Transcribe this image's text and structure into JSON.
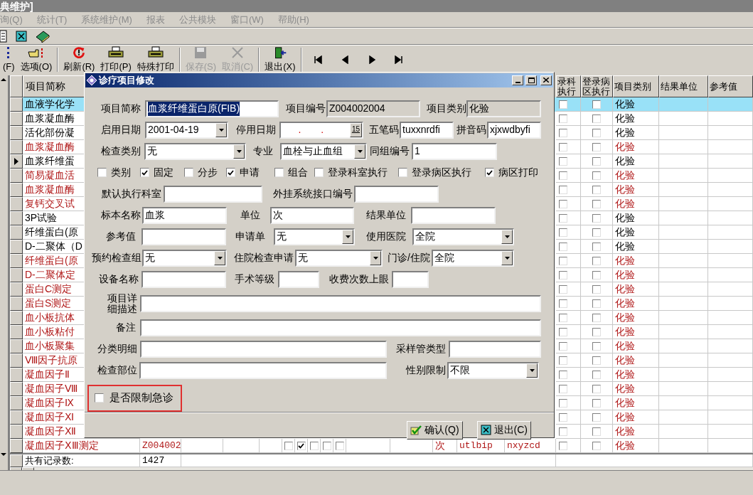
{
  "window": {
    "title": "典维护]"
  },
  "menu": [
    {
      "label": "询(Q)",
      "disabled": true
    },
    {
      "label": "统计(T)",
      "disabled": true
    },
    {
      "label": "系统维护(M)",
      "disabled": true
    },
    {
      "label": "报表",
      "disabled": true
    },
    {
      "label": "公共模块",
      "disabled": true
    },
    {
      "label": "窗口(W)",
      "disabled": true
    },
    {
      "label": "帮助(H)",
      "disabled": true
    }
  ],
  "quick_icons": [
    {
      "kind": "document"
    },
    {
      "kind": "close"
    },
    {
      "kind": "book"
    }
  ],
  "toolbar": [
    {
      "kind": "dots",
      "label": "(F)",
      "disabled": false,
      "divider_after": false
    },
    {
      "kind": "options",
      "label": "选项(O)",
      "disabled": false,
      "divider_after": true
    },
    {
      "kind": "refresh",
      "label": "刷新(R)",
      "disabled": false,
      "divider_after": false
    },
    {
      "kind": "print",
      "label": "打印(P)",
      "disabled": false,
      "divider_after": false
    },
    {
      "kind": "print",
      "label": "特殊打印",
      "disabled": false,
      "divider_after": true
    },
    {
      "kind": "save",
      "label": "保存(S)",
      "disabled": true,
      "divider_after": false
    },
    {
      "kind": "cancel",
      "label": "取消(C)",
      "disabled": true,
      "divider_after": true
    },
    {
      "kind": "exit",
      "label": "退出(X)",
      "disabled": false,
      "divider_after": true
    }
  ],
  "nav": [
    {
      "kind": "first"
    },
    {
      "kind": "prev"
    },
    {
      "kind": "next"
    },
    {
      "kind": "last"
    }
  ],
  "grid": {
    "name_header": "项目简称",
    "right_headers": [
      [
        "录科",
        "执行"
      ],
      [
        "登录病",
        "区执行"
      ],
      [
        "项目类别"
      ],
      [
        "结果单位"
      ],
      [
        "参考值"
      ]
    ],
    "rows": [
      {
        "name": "血液学化学",
        "color": "#000000",
        "selected": true,
        "current": false,
        "exec_dept": false,
        "exec_ward": false,
        "category": "化验"
      },
      {
        "name": "血浆凝血酶",
        "color": "#000000",
        "selected": false,
        "current": false,
        "exec_dept": false,
        "exec_ward": false,
        "category": "化验"
      },
      {
        "name": "活化部份凝",
        "color": "#000000",
        "selected": false,
        "current": false,
        "exec_dept": false,
        "exec_ward": false,
        "category": "化验"
      },
      {
        "name": "血浆凝血酶",
        "color": "#b01818",
        "selected": false,
        "current": false,
        "exec_dept": false,
        "exec_ward": false,
        "category": "化验"
      },
      {
        "name": "血浆纤维蛋",
        "color": "#000000",
        "selected": false,
        "current": true,
        "exec_dept": false,
        "exec_ward": false,
        "category": "化验"
      },
      {
        "name": "简易凝血活",
        "color": "#b01818",
        "selected": false,
        "current": false,
        "exec_dept": false,
        "exec_ward": false,
        "category": "化验"
      },
      {
        "name": "血浆凝血酶",
        "color": "#b01818",
        "selected": false,
        "current": false,
        "exec_dept": false,
        "exec_ward": false,
        "category": "化验"
      },
      {
        "name": "复钙交叉试",
        "color": "#b01818",
        "selected": false,
        "current": false,
        "exec_dept": false,
        "exec_ward": false,
        "category": "化验"
      },
      {
        "name": "3P试验",
        "color": "#000000",
        "selected": false,
        "current": false,
        "exec_dept": false,
        "exec_ward": false,
        "category": "化验"
      },
      {
        "name": "纤维蛋白(原",
        "color": "#000000",
        "selected": false,
        "current": false,
        "exec_dept": false,
        "exec_ward": false,
        "category": "化验"
      },
      {
        "name": "D-二聚体（D",
        "color": "#000000",
        "selected": false,
        "current": false,
        "exec_dept": false,
        "exec_ward": false,
        "category": "化验"
      },
      {
        "name": "纤维蛋白(原",
        "color": "#b01818",
        "selected": false,
        "current": false,
        "exec_dept": false,
        "exec_ward": false,
        "category": "化验"
      },
      {
        "name": "D-二聚体定",
        "color": "#b01818",
        "selected": false,
        "current": false,
        "exec_dept": false,
        "exec_ward": false,
        "category": "化验"
      },
      {
        "name": "蛋白C测定",
        "color": "#b01818",
        "selected": false,
        "current": false,
        "exec_dept": false,
        "exec_ward": false,
        "category": "化验"
      },
      {
        "name": "蛋白S测定",
        "color": "#b01818",
        "selected": false,
        "current": false,
        "exec_dept": false,
        "exec_ward": false,
        "category": "化验"
      },
      {
        "name": "血小板抗体",
        "color": "#b01818",
        "selected": false,
        "current": false,
        "exec_dept": false,
        "exec_ward": false,
        "category": "化验"
      },
      {
        "name": "血小板粘付",
        "color": "#b01818",
        "selected": false,
        "current": false,
        "exec_dept": false,
        "exec_ward": false,
        "category": "化验"
      },
      {
        "name": "血小板聚集",
        "color": "#b01818",
        "selected": false,
        "current": false,
        "exec_dept": false,
        "exec_ward": false,
        "category": "化验"
      },
      {
        "name": "Ⅷ因子抗原",
        "color": "#b01818",
        "selected": false,
        "current": false,
        "exec_dept": false,
        "exec_ward": false,
        "category": "化验"
      },
      {
        "name": "凝血因子Ⅱ",
        "color": "#b01818",
        "selected": false,
        "current": false,
        "exec_dept": false,
        "exec_ward": false,
        "category": "化验"
      },
      {
        "name": "凝血因子Ⅷ",
        "color": "#b01818",
        "selected": false,
        "current": false,
        "exec_dept": false,
        "exec_ward": false,
        "category": "化验"
      },
      {
        "name": "凝血因子Ⅸ",
        "color": "#b01818",
        "selected": false,
        "current": false,
        "exec_dept": false,
        "exec_ward": false,
        "category": "化验"
      },
      {
        "name": "凝血因子Ⅺ",
        "color": "#b01818",
        "selected": false,
        "current": false,
        "exec_dept": false,
        "exec_ward": false,
        "category": "化验"
      },
      {
        "name": "凝血因子Ⅻ",
        "color": "#b01818",
        "selected": false,
        "current": false,
        "exec_dept": false,
        "exec_ward": false,
        "category": "化验"
      },
      {
        "name": "凝血因子ⅩⅢ测定",
        "color": "#b01818",
        "selected": false,
        "current": false,
        "exec_dept": false,
        "exec_ward": false,
        "category": "化验",
        "code": "Z004002",
        "flags": [
          false,
          true,
          false,
          false,
          false
        ],
        "unit": "次",
        "wubi": "utlbip",
        "pinyin": "nxyzcd"
      }
    ],
    "total": {
      "label": "共有记录数:",
      "count": "1427"
    }
  },
  "dialog": {
    "title": "诊疗项目修改",
    "rows": [
      {
        "items": [
          {
            "kind": "label",
            "text": "项目简称"
          },
          {
            "kind": "field",
            "value": "血浆纤维蛋白原(FIB)",
            "text_selected": true
          },
          {
            "kind": "label",
            "text": "项目编号"
          },
          {
            "kind": "field",
            "value": "Z004002004",
            "readonly": true
          },
          {
            "kind": "label",
            "text": "项目类别"
          },
          {
            "kind": "field",
            "value": "化验",
            "readonly": true
          }
        ]
      },
      {
        "items": [
          {
            "kind": "label",
            "text": "启用日期"
          },
          {
            "kind": "combo",
            "value": "2001-04-19"
          },
          {
            "kind": "label",
            "text": "停用日期"
          },
          {
            "kind": "date",
            "mask": ". .",
            "button_text": "15"
          },
          {
            "kind": "label",
            "text": "五笔码"
          },
          {
            "kind": "field",
            "value": "tuxxnrdfi"
          },
          {
            "kind": "label",
            "text": "拼音码"
          },
          {
            "kind": "field",
            "value": "xjxwdbyfi"
          }
        ]
      },
      {
        "items": [
          {
            "kind": "label",
            "text": "检查类别"
          },
          {
            "kind": "combo",
            "value": "无"
          },
          {
            "kind": "label",
            "text": "专业"
          },
          {
            "kind": "combo",
            "value": "血栓与止血组"
          },
          {
            "kind": "label",
            "text": "同组编号"
          },
          {
            "kind": "field",
            "value": "1"
          }
        ]
      },
      {
        "items": [
          {
            "kind": "check",
            "label": "类别",
            "checked": false
          },
          {
            "kind": "check",
            "label": "固定",
            "checked": true
          },
          {
            "kind": "check",
            "label": "分步",
            "checked": false
          },
          {
            "kind": "check",
            "label": "申请",
            "checked": true
          },
          {
            "kind": "check",
            "label": "组合",
            "checked": false
          },
          {
            "kind": "check",
            "label": "登录科室执行",
            "checked": false
          },
          {
            "kind": "check",
            "label": "登录病区执行",
            "checked": false
          },
          {
            "kind": "check",
            "label": "病区打印",
            "checked": true
          }
        ]
      },
      {
        "items": [
          {
            "kind": "label",
            "text": "默认执行科室"
          },
          {
            "kind": "field"
          },
          {
            "kind": "label",
            "text": "外挂系统接口编号"
          },
          {
            "kind": "field"
          }
        ]
      },
      {
        "items": [
          {
            "kind": "label",
            "text": "标本名称"
          },
          {
            "kind": "field",
            "value": "血浆"
          },
          {
            "kind": "label",
            "text": "单位"
          },
          {
            "kind": "field",
            "value": "次"
          },
          {
            "kind": "label",
            "text": "结果单位"
          },
          {
            "kind": "field"
          }
        ]
      },
      {
        "items": [
          {
            "kind": "label",
            "text": "参考值"
          },
          {
            "kind": "field"
          },
          {
            "kind": "label",
            "text": "申请单"
          },
          {
            "kind": "combo",
            "value": "无"
          },
          {
            "kind": "label",
            "text": "使用医院"
          },
          {
            "kind": "combo",
            "value": "全院"
          }
        ]
      },
      {
        "items": [
          {
            "kind": "label",
            "text": "预约检查组"
          },
          {
            "kind": "combo",
            "value": "无"
          },
          {
            "kind": "label",
            "text": "住院检查申请"
          },
          {
            "kind": "combo",
            "value": "无"
          },
          {
            "kind": "label",
            "text": "门诊/住院"
          },
          {
            "kind": "combo",
            "value": "全院"
          }
        ]
      },
      {
        "items": [
          {
            "kind": "label",
            "text": "设备名称"
          },
          {
            "kind": "field"
          },
          {
            "kind": "label",
            "text": "手术等级"
          },
          {
            "kind": "field"
          },
          {
            "kind": "label",
            "text": "收费次数上眼"
          },
          {
            "kind": "field"
          }
        ]
      },
      {
        "items": [
          {
            "kind": "label",
            "lines": [
              "项目详",
              "细描述"
            ]
          },
          {
            "kind": "field"
          }
        ]
      },
      {
        "items": [
          {
            "kind": "label",
            "text": "备注"
          },
          {
            "kind": "field"
          }
        ]
      },
      {
        "items": [
          {
            "kind": "label",
            "text": "分类明细"
          },
          {
            "kind": "field"
          },
          {
            "kind": "label",
            "text": "采样管类型"
          },
          {
            "kind": "field"
          }
        ]
      },
      {
        "items": [
          {
            "kind": "label",
            "text": "检查部位"
          },
          {
            "kind": "field"
          },
          {
            "kind": "label",
            "text": "性别限制"
          },
          {
            "kind": "combo",
            "value": "不限"
          }
        ]
      },
      {
        "items": [
          {
            "kind": "highlight_check",
            "label": "是否限制急诊",
            "checked": false
          }
        ]
      }
    ],
    "buttons": [
      {
        "kind": "ok",
        "label": "确认(Q)"
      },
      {
        "kind": "exit",
        "label": "退出(C)"
      }
    ]
  }
}
